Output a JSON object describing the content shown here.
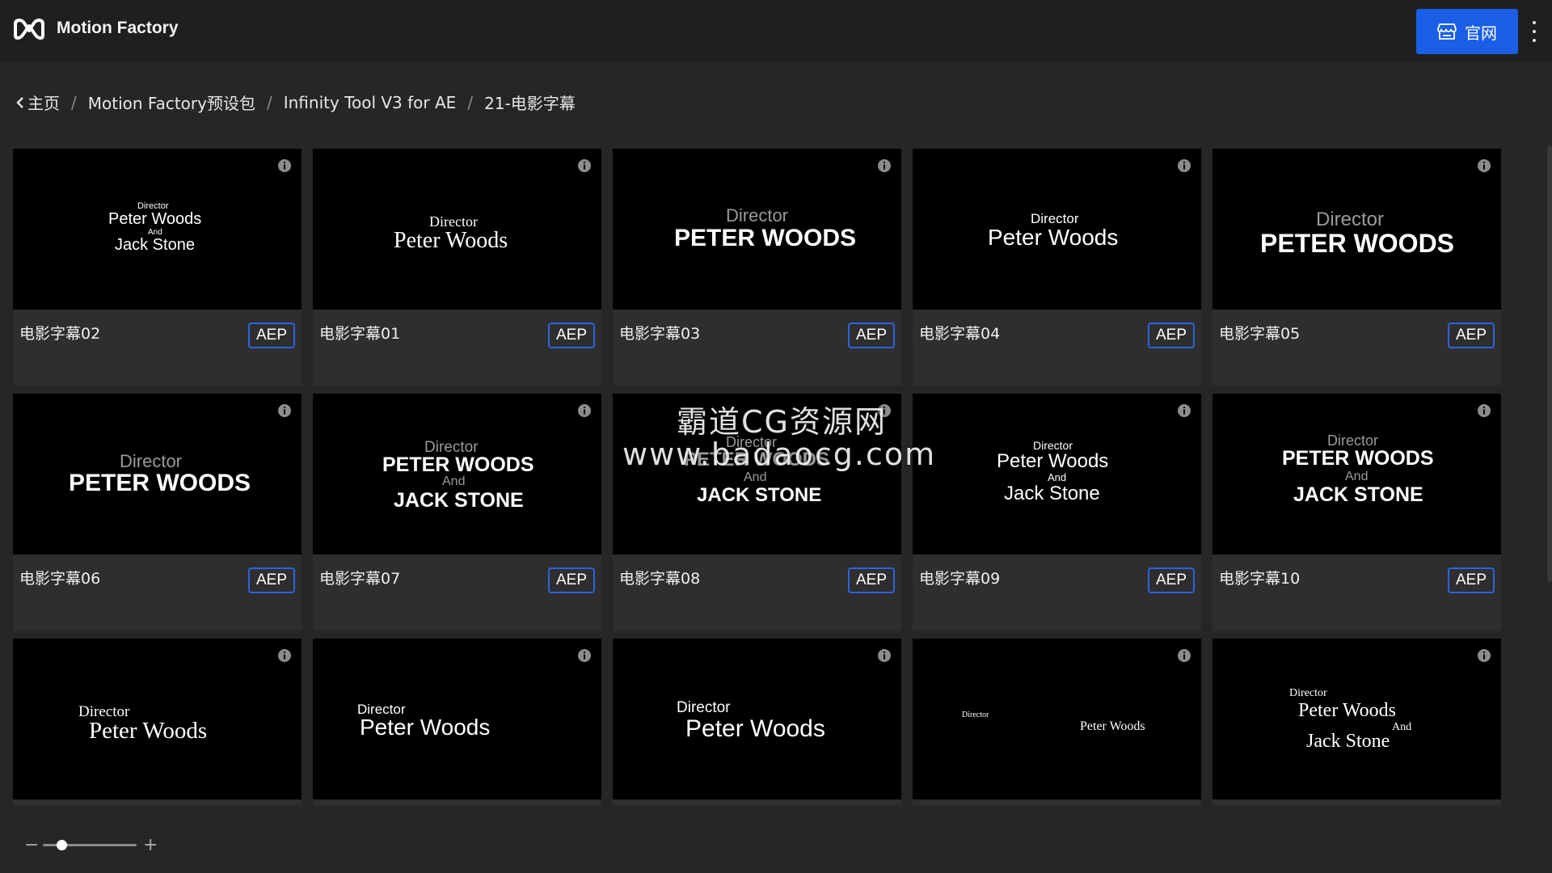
{
  "app": {
    "title": "Motion Factory",
    "site_button_label": "官网"
  },
  "breadcrumb": {
    "home": "主页",
    "items": [
      "Motion Factory预设包",
      "Infinity Tool V3 for AE",
      "21-电影字幕"
    ],
    "separator": "/"
  },
  "badge_label": "AEP",
  "cards": [
    {
      "name": "电影字幕02",
      "lines": [
        "Director",
        "Peter Woods",
        "And",
        "Jack Stone"
      ]
    },
    {
      "name": "电影字幕01",
      "lines": [
        "Director",
        "Peter Woods"
      ]
    },
    {
      "name": "电影字幕03",
      "lines": [
        "Director",
        "PETER WOODS"
      ]
    },
    {
      "name": "电影字幕04",
      "lines": [
        "Director",
        "Peter Woods"
      ]
    },
    {
      "name": "电影字幕05",
      "lines": [
        "Director",
        "PETER WOODS"
      ]
    },
    {
      "name": "电影字幕06",
      "lines": [
        "Director",
        "PETER WOODS"
      ]
    },
    {
      "name": "电影字幕07",
      "lines": [
        "Director",
        "PETER WOODS",
        "And",
        "JACK STONE"
      ]
    },
    {
      "name": "电影字幕08",
      "lines": [
        "Director",
        "PETER WOODS",
        "And",
        "JACK STONE"
      ]
    },
    {
      "name": "电影字幕09",
      "lines": [
        "Director",
        "Peter Woods",
        "And",
        "Jack Stone"
      ]
    },
    {
      "name": "电影字幕10",
      "lines": [
        "Director",
        "PETER WOODS",
        "And",
        "JACK STONE"
      ]
    },
    {
      "name": "",
      "lines": [
        "Director",
        "Peter Woods"
      ]
    },
    {
      "name": "",
      "lines": [
        "Director",
        "Peter Woods"
      ]
    },
    {
      "name": "",
      "lines": [
        "Director",
        "Peter Woods"
      ]
    },
    {
      "name": "",
      "lines": [
        "Director",
        "Peter Woods"
      ]
    },
    {
      "name": "",
      "lines": [
        "Director",
        "Peter Woods",
        "And",
        "Jack Stone"
      ]
    }
  ],
  "watermark": {
    "line1": "霸道CG资源网",
    "line2": "www.badaocg.com"
  },
  "zoom": {
    "minus": "−",
    "plus": "+",
    "level": 0.2
  },
  "colors": {
    "accent": "#1b5fe6",
    "badge_border": "#2d63e0",
    "background": "#262626",
    "topbar": "#1f1f1f"
  }
}
